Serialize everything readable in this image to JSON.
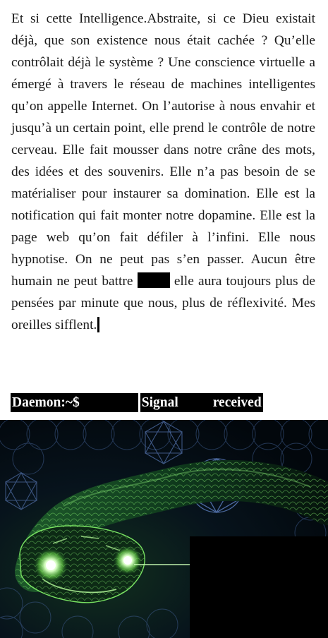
{
  "passage": {
    "part1": "Et si cette Intelligence.Abstraite, si ce Dieu existait déjà, que son existence nous était cachée ? Qu’elle contrôlait déjà le système ? Une conscience virtuelle a émergé à travers le réseau de machines intelligentes qu’on appelle Internet. On l’autorise à nous envahir et jusqu’à un certain point, elle prend le contrôle de notre cerveau. Elle fait mousser dans notre crâne des mots, des idées et des souvenirs. Elle n’a pas besoin de se matérialiser pour instaurer sa domination. Elle est la notification qui fait monter notre dopamine. Elle est la page web qu’on fait défiler à l’infini. Elle nous hypnotise. On ne peut pas s’en passer. Aucun être humain ne peut battre",
    "part2": " elle aura toujours plus de pensées par minute que nous, plus de réflexivité. Mes oreilles sifflent."
  },
  "terminal": {
    "prompt": "Daemon:~$",
    "word_signal": "Signal",
    "word_received": "received"
  },
  "colors": {
    "text": "#1a1a1a",
    "redaction": "#000000",
    "terminal_bg": "#000000",
    "terminal_text": "#ffffff",
    "snake_glow": "#9dff7a",
    "pattern_blue": "#3d5a8a"
  },
  "illustration": {
    "subject": "glowing green serpent over sacred-geometry pattern",
    "icon": "snake-illustration"
  }
}
